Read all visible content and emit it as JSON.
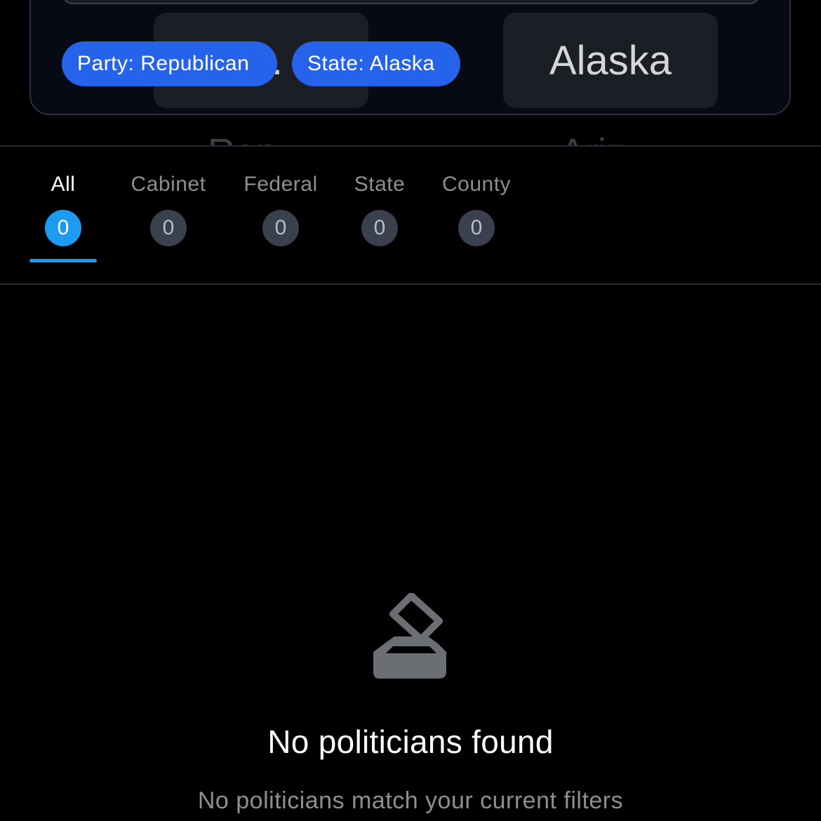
{
  "filters": {
    "party_picker_value": "0.",
    "state_picker_value": "Alaska",
    "active_chips": [
      {
        "label": "Party: Republican"
      },
      {
        "label": "State: Alaska"
      }
    ],
    "background_labels": [
      "Rep",
      "Ariz"
    ]
  },
  "tabs": [
    {
      "label": "All",
      "count": "0",
      "active": true
    },
    {
      "label": "Cabinet",
      "count": "0",
      "active": false
    },
    {
      "label": "Federal",
      "count": "0",
      "active": false
    },
    {
      "label": "State",
      "count": "0",
      "active": false
    },
    {
      "label": "County",
      "count": "0",
      "active": false
    }
  ],
  "empty_state": {
    "icon": "ballot-box-icon",
    "title": "No politicians found",
    "subtitle": "No politicians match your current filters"
  },
  "colors": {
    "accent": "#1d9bf0",
    "chip": "#2563eb",
    "background": "#000000",
    "muted_text": "#8e8e93"
  }
}
